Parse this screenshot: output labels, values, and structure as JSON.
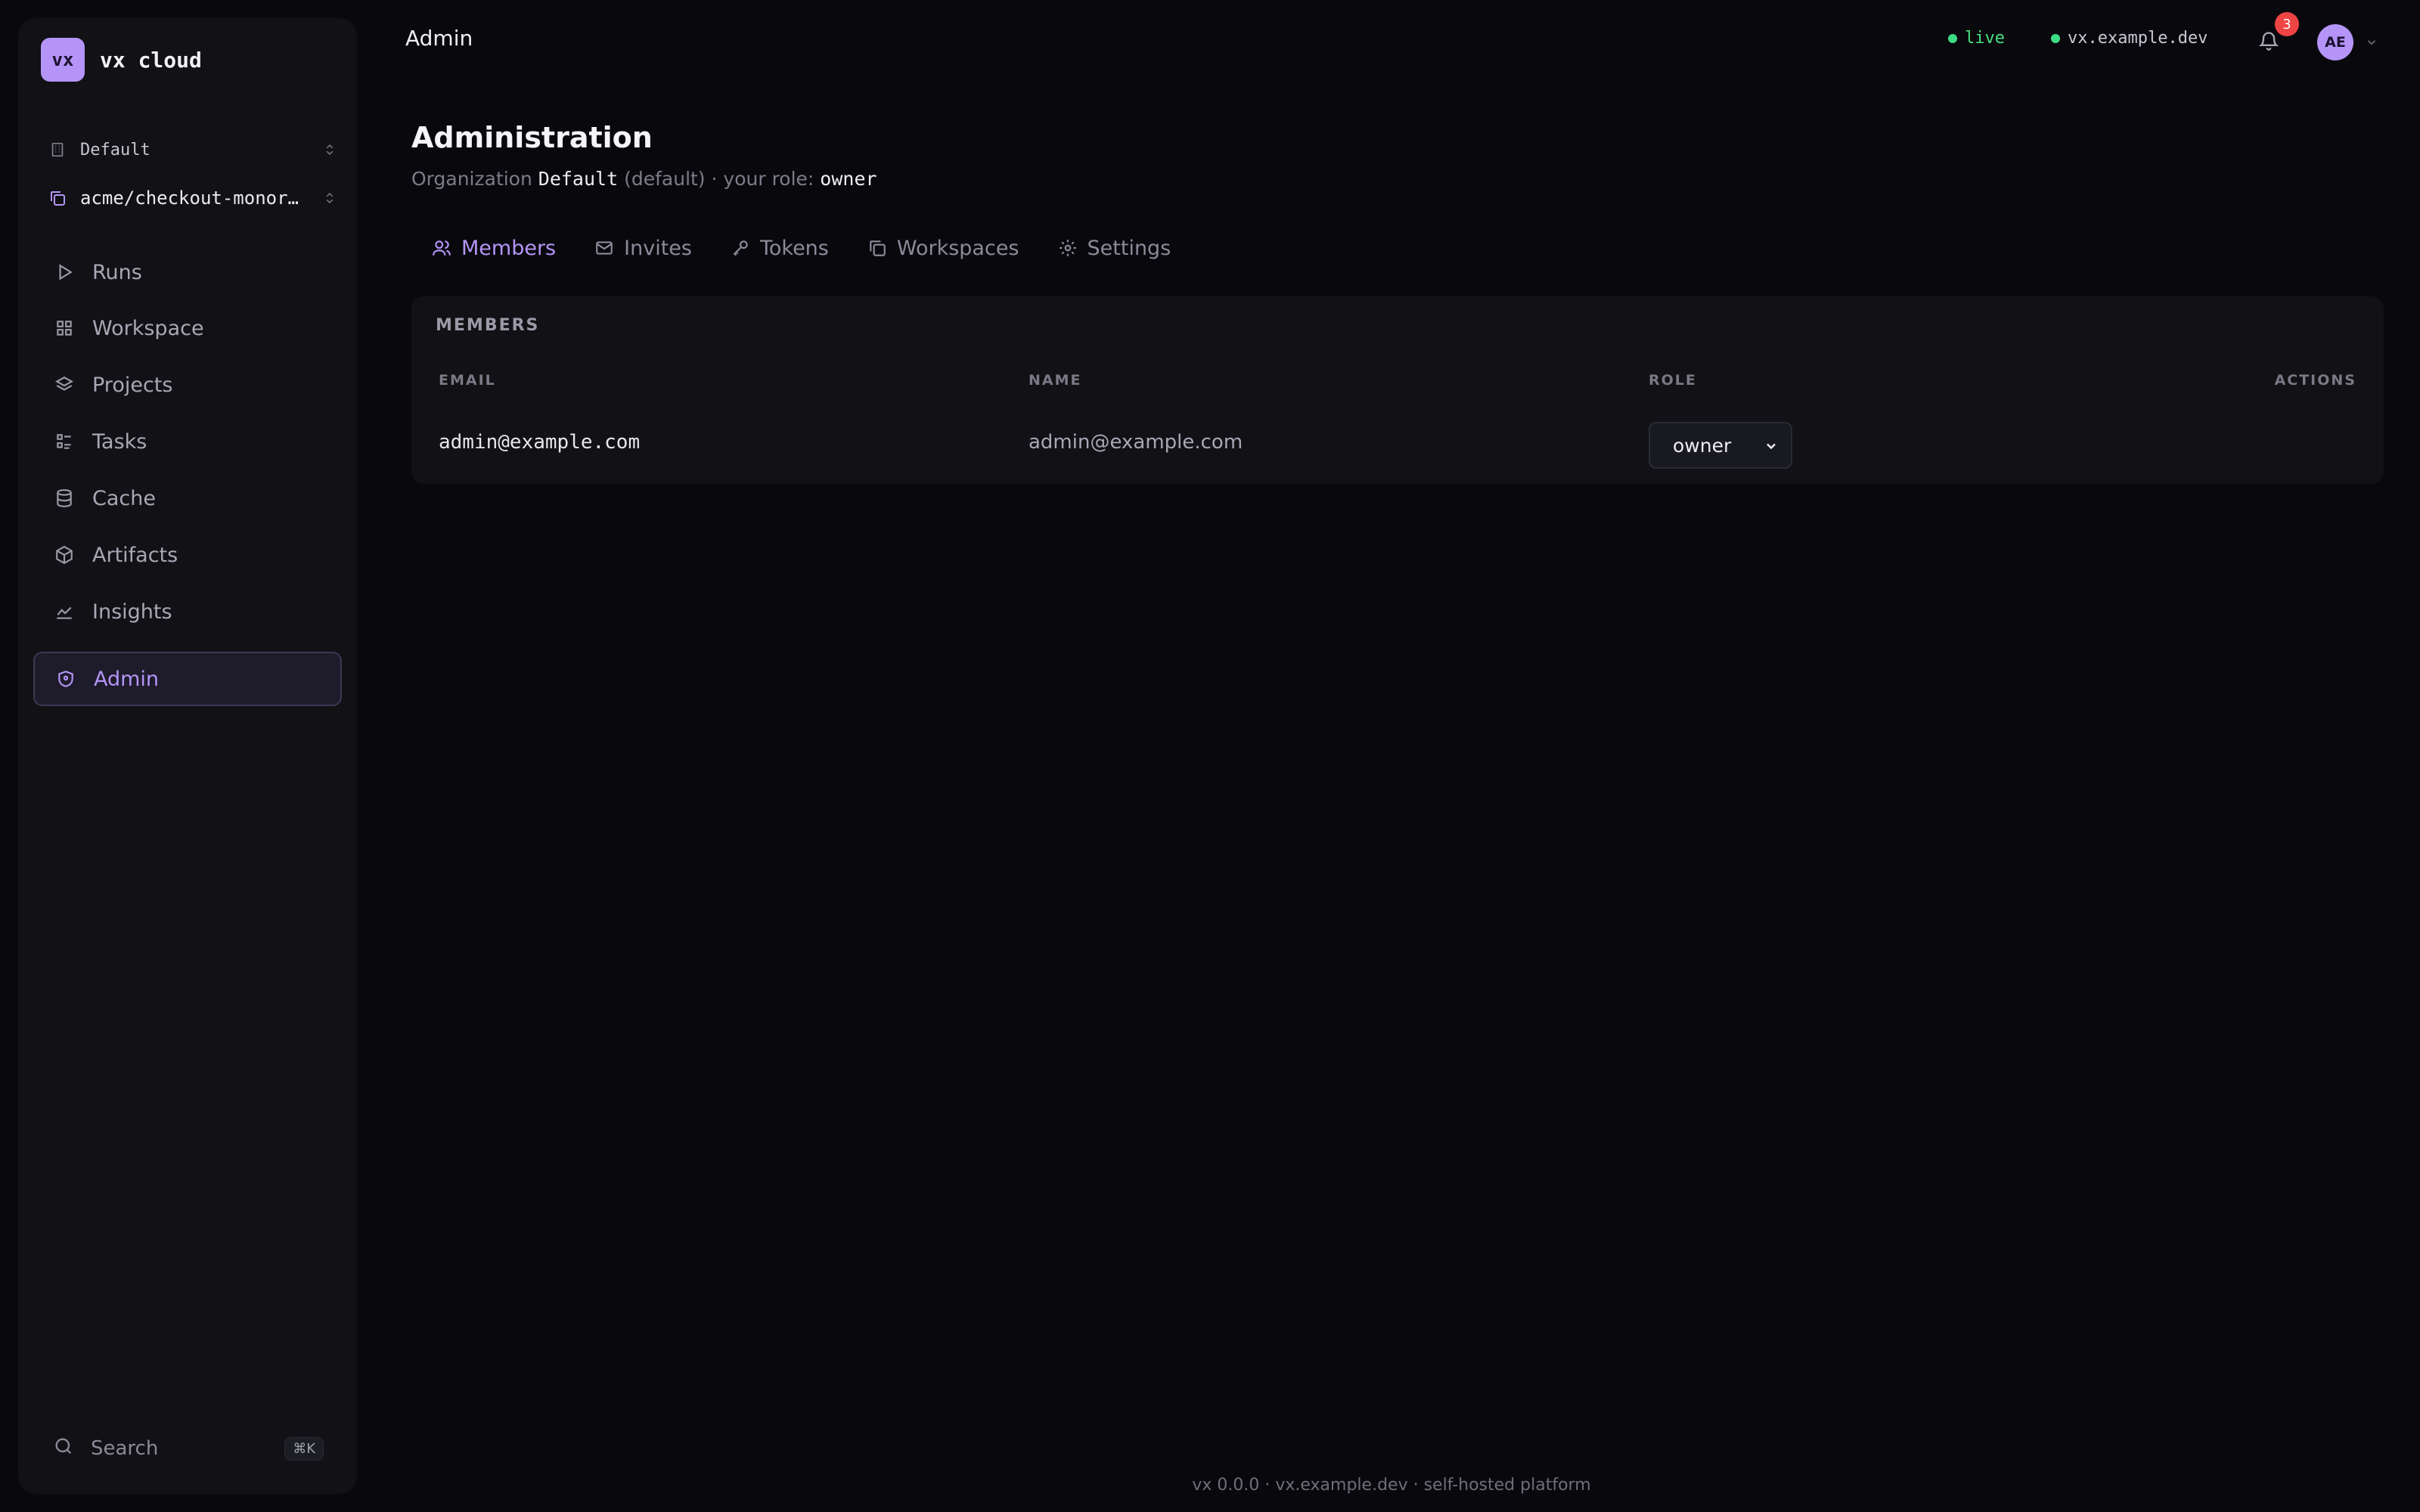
{
  "brand": {
    "logo": "vx",
    "name": "vx cloud"
  },
  "org_selector": {
    "label": "Default",
    "icon": "building-icon"
  },
  "project_selector": {
    "label": "acme/checkout-monor…",
    "icon": "copy-icon"
  },
  "sidebar": {
    "items": [
      {
        "label": "Runs",
        "icon": "play-icon",
        "active": false
      },
      {
        "label": "Workspace",
        "icon": "grid-icon",
        "active": false
      },
      {
        "label": "Projects",
        "icon": "layers-icon",
        "active": false
      },
      {
        "label": "Tasks",
        "icon": "list-checks-icon",
        "active": false
      },
      {
        "label": "Cache",
        "icon": "database-icon",
        "active": false
      },
      {
        "label": "Artifacts",
        "icon": "package-icon",
        "active": false
      },
      {
        "label": "Insights",
        "icon": "line-chart-icon",
        "active": false
      },
      {
        "label": "Admin",
        "icon": "shield-icon",
        "active": true
      }
    ],
    "search_label": "Search",
    "search_shortcut": "⌘K"
  },
  "header": {
    "title": "Admin",
    "live_label": "live",
    "host_label": "vx.example.dev",
    "notification_count": "3",
    "avatar_initials": "AE"
  },
  "page": {
    "title": "Administration",
    "subtitle": {
      "prefix": "Organization",
      "org": "Default",
      "org_suffix": "(default) · your role:",
      "role": "owner"
    }
  },
  "tabs": [
    {
      "label": "Members",
      "icon": "users-icon",
      "active": true
    },
    {
      "label": "Invites",
      "icon": "mail-icon",
      "active": false
    },
    {
      "label": "Tokens",
      "icon": "key-icon",
      "active": false
    },
    {
      "label": "Workspaces",
      "icon": "copy-icon",
      "active": false
    },
    {
      "label": "Settings",
      "icon": "gear-icon",
      "active": false
    }
  ],
  "members": {
    "title": "MEMBERS",
    "columns": {
      "email": "EMAIL",
      "name": "NAME",
      "role": "ROLE",
      "actions": "ACTIONS"
    },
    "rows": [
      {
        "email": "admin@example.com",
        "name": "admin@example.com",
        "role": "owner"
      }
    ]
  },
  "footer": "vx 0.0.0 · vx.example.dev · self-hosted platform",
  "colors": {
    "accent": "#b594f7",
    "live": "#4ade80",
    "badge": "#ef4444",
    "background": "#09090d",
    "panel": "#111116"
  }
}
